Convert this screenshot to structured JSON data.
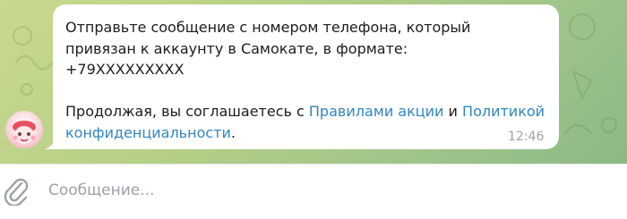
{
  "message": {
    "line1": "Отправьте сообщение с номером телефона, который",
    "line2": "привязан к аккаунту в Самокате, в формате:",
    "line3": "+79XXXXXXXXX",
    "p2_text1": "Продолжая, вы соглашаетесь с ",
    "p2_link1": "Правилами акции",
    "p2_text2": " и ",
    "p2_link2": "Политикой",
    "p2_link2b": "конфиденциальности",
    "p2_text3": ".",
    "time": "12:46"
  },
  "composer": {
    "placeholder": "Сообщение..."
  },
  "icons": {
    "attach": "paperclip-icon",
    "avatar": "bot-avatar"
  },
  "colors": {
    "link": "#2f86c1",
    "bubble": "#ffffff",
    "chat_background": "#b5cf86"
  }
}
